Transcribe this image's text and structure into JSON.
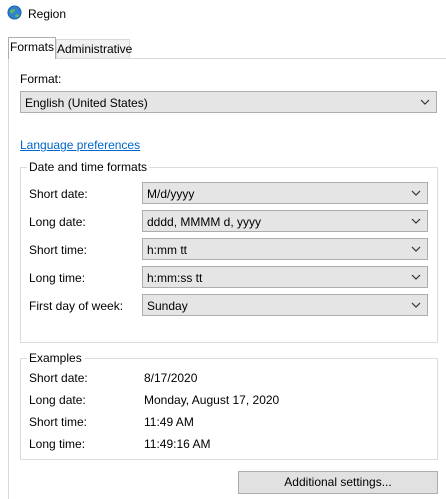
{
  "window": {
    "title": "Region"
  },
  "tabs": [
    {
      "label": "Formats",
      "active": true
    },
    {
      "label": "Administrative",
      "active": false
    }
  ],
  "format": {
    "label": "Format:",
    "selected": "English (United States)"
  },
  "language_preferences_link": "Language preferences",
  "date_time_formats": {
    "title": "Date and time formats",
    "short_date": {
      "label": "Short date:",
      "value": "M/d/yyyy"
    },
    "long_date": {
      "label": "Long date:",
      "value": "dddd, MMMM d, yyyy"
    },
    "short_time": {
      "label": "Short time:",
      "value": "h:mm tt"
    },
    "long_time": {
      "label": "Long time:",
      "value": "h:mm:ss tt"
    },
    "first_day": {
      "label": "First day of week:",
      "value": "Sunday"
    }
  },
  "examples": {
    "title": "Examples",
    "short_date": {
      "label": "Short date:",
      "value": "8/17/2020"
    },
    "long_date": {
      "label": "Long date:",
      "value": "Monday, August 17, 2020"
    },
    "short_time": {
      "label": "Short time:",
      "value": "11:49 AM"
    },
    "long_time": {
      "label": "Long time:",
      "value": "11:49:16 AM"
    }
  },
  "additional_settings_button": "Additional settings...",
  "colors": {
    "link": "#0066cc",
    "combo_bg": "#e5e5e5",
    "button_bg": "#e1e1e1"
  }
}
